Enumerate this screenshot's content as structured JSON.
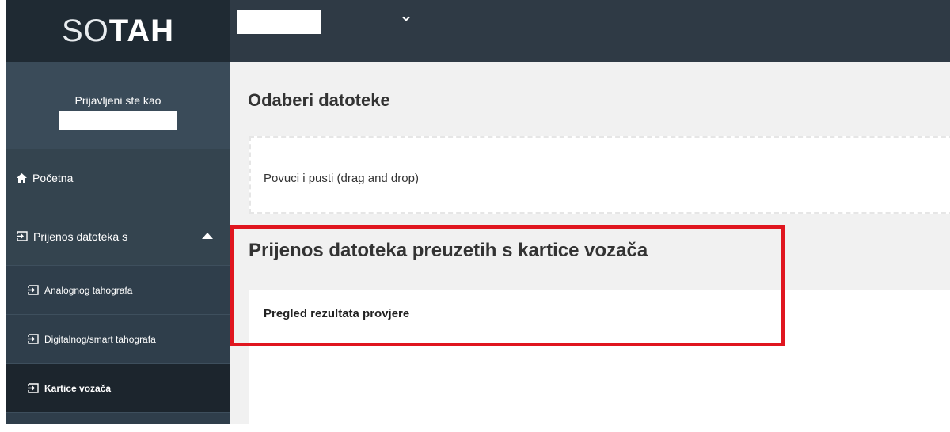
{
  "logo": {
    "light": "SO",
    "bold": "TAH"
  },
  "user": {
    "logged_in_label": "Prijavljeni ste kao",
    "name": ""
  },
  "topbar": {
    "company": ""
  },
  "nav": {
    "home": "Početna",
    "prijenos": "Prijenos datoteka s",
    "sub_items": [
      "Analognog tahografa",
      "Digitalnog/smart tahografa",
      "Kartice vozača"
    ]
  },
  "main": {
    "select_files_title": "Odaberi datoteke",
    "dropzone_text": "Povuci i pusti (drag and drop)",
    "upload_title": "Prijenos datoteka preuzetih s kartice vozača",
    "results_title": "Pregled rezultata provjere"
  },
  "colors": {
    "sidebar": "#2f3e4b",
    "logo_bg": "#1f2a33",
    "active_item": "#1c252d",
    "highlight": "#e0161f"
  }
}
